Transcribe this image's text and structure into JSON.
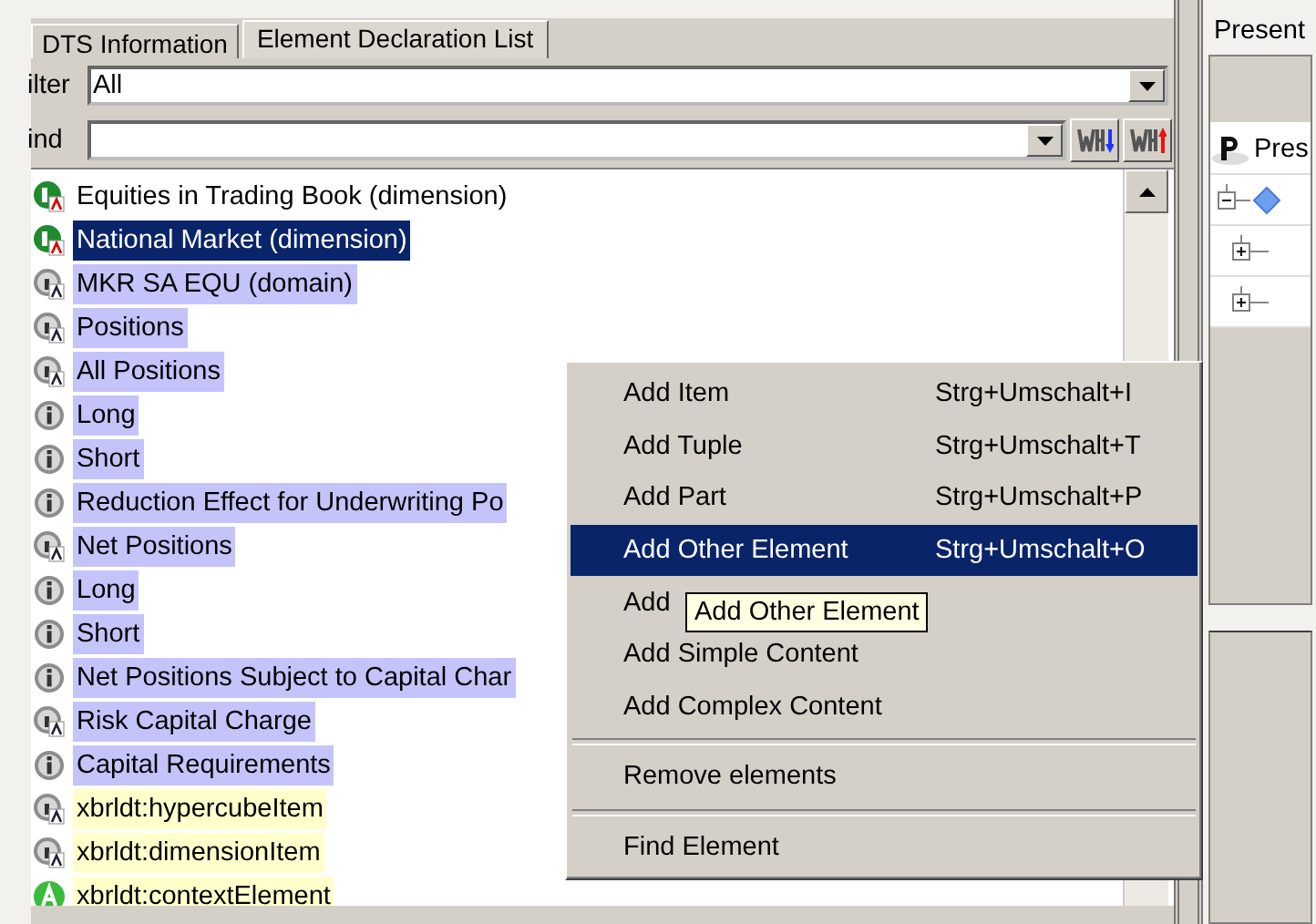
{
  "tabs": [
    {
      "label": "DTS Information",
      "selected": false
    },
    {
      "label": "Element Declaration List",
      "selected": true
    }
  ],
  "filter": {
    "label": "ilter",
    "value": "All"
  },
  "find": {
    "label": "ind"
  },
  "elements": [
    {
      "label": "Equities in Trading Book (dimension)",
      "kind": "dimension",
      "selected": false
    },
    {
      "label": "National Market (dimension)",
      "kind": "dimension",
      "selected": true
    },
    {
      "label": "MKR SA EQU (domain)",
      "kind": "abstract",
      "selected": false,
      "color": "#c4c4fb"
    },
    {
      "label": "Positions",
      "kind": "abstract",
      "selected": false,
      "color": "#c4c4fb"
    },
    {
      "label": "All Positions",
      "kind": "abstract",
      "selected": false,
      "color": "#c4c4fb"
    },
    {
      "label": "Long",
      "kind": "item",
      "selected": false,
      "color": "#c4c4fb"
    },
    {
      "label": "Short",
      "kind": "item",
      "selected": false,
      "color": "#c4c4fb"
    },
    {
      "label": "Reduction Effect for Underwriting Po",
      "kind": "item",
      "selected": false,
      "color": "#c4c4fb"
    },
    {
      "label": "Net Positions",
      "kind": "abstract",
      "selected": false,
      "color": "#c4c4fb"
    },
    {
      "label": "Long",
      "kind": "item",
      "selected": false,
      "color": "#c4c4fb"
    },
    {
      "label": "Short",
      "kind": "item",
      "selected": false,
      "color": "#c4c4fb"
    },
    {
      "label": "Net Positions Subject to Capital Char",
      "kind": "item",
      "selected": false,
      "color": "#c4c4fb"
    },
    {
      "label": "Risk Capital Charge",
      "kind": "abstract",
      "selected": false,
      "color": "#c4c4fb"
    },
    {
      "label": "Capital Requirements",
      "kind": "item",
      "selected": false,
      "color": "#c4c4fb"
    },
    {
      "label": "xbrldt:hypercubeItem",
      "kind": "abstract",
      "selected": false,
      "color": "#ffffcc"
    },
    {
      "label": "xbrldt:dimensionItem",
      "kind": "abstract",
      "selected": false,
      "color": "#ffffcc"
    },
    {
      "label": "xbrldt:contextElement",
      "kind": "element",
      "selected": false,
      "color": "#ffffcc"
    }
  ],
  "context_menu": {
    "items": [
      {
        "kind": "entry",
        "label": "Add Item",
        "shortcut": "Strg+Umschalt+I",
        "selected": false
      },
      {
        "kind": "entry",
        "label": "Add Tuple",
        "shortcut": "Strg+Umschalt+T",
        "selected": false
      },
      {
        "kind": "entry",
        "label": "Add Part",
        "shortcut": "Strg+Umschalt+P",
        "selected": false
      },
      {
        "kind": "entry",
        "label": "Add Other Element",
        "shortcut": "Strg+Umschalt+O",
        "selected": true
      },
      {
        "kind": "entry",
        "label": "Add",
        "selected": false
      },
      {
        "kind": "entry",
        "label": "Add Simple Content",
        "selected": false
      },
      {
        "kind": "entry",
        "label": "Add Complex Content",
        "selected": false
      },
      {
        "kind": "separator"
      },
      {
        "kind": "entry",
        "label": "Remove elements",
        "selected": false
      },
      {
        "kind": "separator"
      },
      {
        "kind": "entry",
        "label": "Find Element",
        "selected": false
      }
    ]
  },
  "tooltip": "Add Other Element",
  "right_panel": {
    "tab": "Present",
    "root": "Pres"
  }
}
